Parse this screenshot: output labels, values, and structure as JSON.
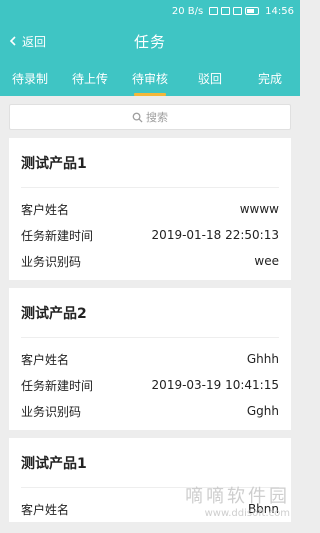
{
  "status": {
    "speed": "20 B/s",
    "time": "14:56"
  },
  "header": {
    "back_label": "返回",
    "title": "任务"
  },
  "tabs": [
    {
      "label": "待录制"
    },
    {
      "label": "待上传"
    },
    {
      "label": "待审核",
      "active": true
    },
    {
      "label": "驳回"
    },
    {
      "label": "完成"
    }
  ],
  "search": {
    "placeholder": "搜索"
  },
  "cards": [
    {
      "title": "测试产品1",
      "rows": [
        {
          "label": "客户姓名",
          "value": "wwww"
        },
        {
          "label": "任务新建时间",
          "value": "2019-01-18 22:50:13"
        },
        {
          "label": "业务识别码",
          "value": "wee"
        }
      ]
    },
    {
      "title": "测试产品2",
      "rows": [
        {
          "label": "客户姓名",
          "value": "Ghhh"
        },
        {
          "label": "任务新建时间",
          "value": "2019-03-19 10:41:15"
        },
        {
          "label": "业务识别码",
          "value": "Gghh"
        }
      ]
    },
    {
      "title": "测试产品1",
      "rows": [
        {
          "label": "客户姓名",
          "value": "Bbnn"
        }
      ]
    }
  ],
  "watermark": {
    "name": "嘀嘀软件园",
    "url": "www.ddisoft.com"
  },
  "colors": {
    "primary": "#3fc5c4",
    "tab_indicator": "#f4b73a",
    "background": "#ededed"
  }
}
